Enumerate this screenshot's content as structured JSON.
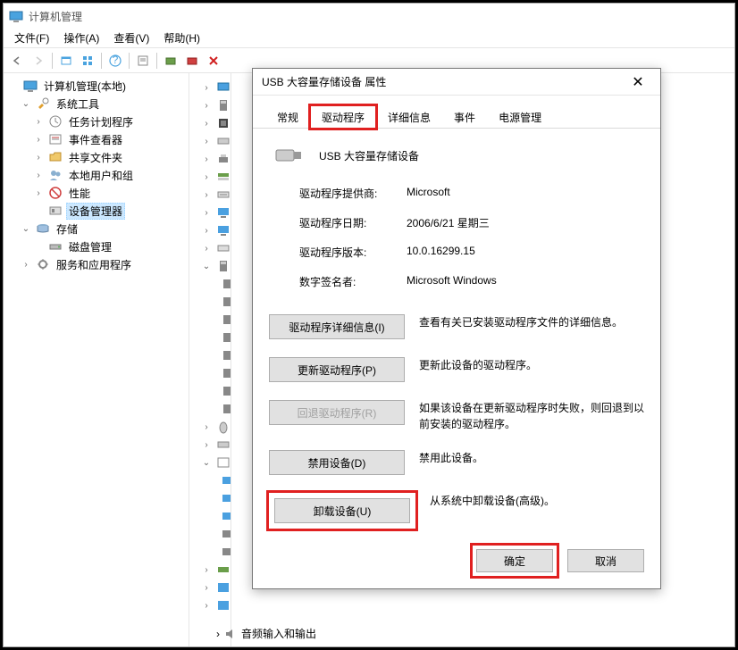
{
  "window": {
    "title": "计算机管理"
  },
  "menu": {
    "file": "文件(F)",
    "action": "操作(A)",
    "view": "查看(V)",
    "help": "帮助(H)"
  },
  "tree": {
    "root": "计算机管理(本地)",
    "system_tools": "系统工具",
    "task_scheduler": "任务计划程序",
    "event_viewer": "事件查看器",
    "shared_folders": "共享文件夹",
    "local_users": "本地用户和组",
    "performance": "性能",
    "device_manager": "设备管理器",
    "storage": "存储",
    "disk_mgmt": "磁盘管理",
    "services_apps": "服务和应用程序"
  },
  "bottom_item": "音频输入和输出",
  "dialog": {
    "title": "USB 大容量存储设备 属性",
    "tabs": {
      "general": "常规",
      "driver": "驱动程序",
      "details": "详细信息",
      "events": "事件",
      "power": "电源管理"
    },
    "device_name": "USB 大容量存储设备",
    "provider_k": "驱动程序提供商:",
    "provider_v": "Microsoft",
    "date_k": "驱动程序日期:",
    "date_v": "2006/6/21 星期三",
    "version_k": "驱动程序版本:",
    "version_v": "10.0.16299.15",
    "signer_k": "数字签名者:",
    "signer_v": "Microsoft Windows",
    "btn_details": "驱动程序详细信息(I)",
    "btn_details_desc": "查看有关已安装驱动程序文件的详细信息。",
    "btn_update": "更新驱动程序(P)",
    "btn_update_desc": "更新此设备的驱动程序。",
    "btn_rollback": "回退驱动程序(R)",
    "btn_rollback_desc": "如果该设备在更新驱动程序时失败，则回退到以前安装的驱动程序。",
    "btn_disable": "禁用设备(D)",
    "btn_disable_desc": "禁用此设备。",
    "btn_uninstall": "卸载设备(U)",
    "btn_uninstall_desc": "从系统中卸载设备(高级)。",
    "ok": "确定",
    "cancel": "取消"
  }
}
